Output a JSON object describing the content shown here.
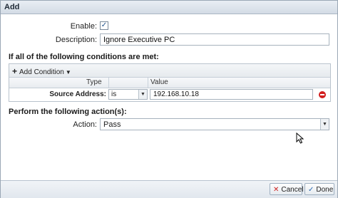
{
  "dialog": {
    "title": "Add"
  },
  "fields": {
    "enable_label": "Enable:",
    "enable_checked": true,
    "description_label": "Description:",
    "description_value": "Ignore Executive PC"
  },
  "conditions": {
    "section_title": "If all of the following conditions are met:",
    "add_condition_label": "Add Condition",
    "columns": {
      "type": "Type",
      "value": "Value"
    },
    "rows": [
      {
        "type": "Source Address:",
        "operator": "is",
        "value": "192.168.10.18"
      }
    ]
  },
  "actions": {
    "section_title": "Perform the following action(s):",
    "action_label": "Action:",
    "action_value": "Pass"
  },
  "footer": {
    "cancel_label": "Cancel",
    "done_label": "Done"
  },
  "icons": {
    "checkbox": "checkmark-icon",
    "add": "plus-icon",
    "dropdown": "chevron-down-icon",
    "remove": "remove-circle-icon",
    "cancel": "cancel-x-icon",
    "done": "done-check-icon",
    "cursor": "mouse-pointer-icon"
  },
  "colors": {
    "remove": "#d21f1f",
    "done_icon": "#2a6ab3",
    "cancel_icon": "#cc2222"
  }
}
